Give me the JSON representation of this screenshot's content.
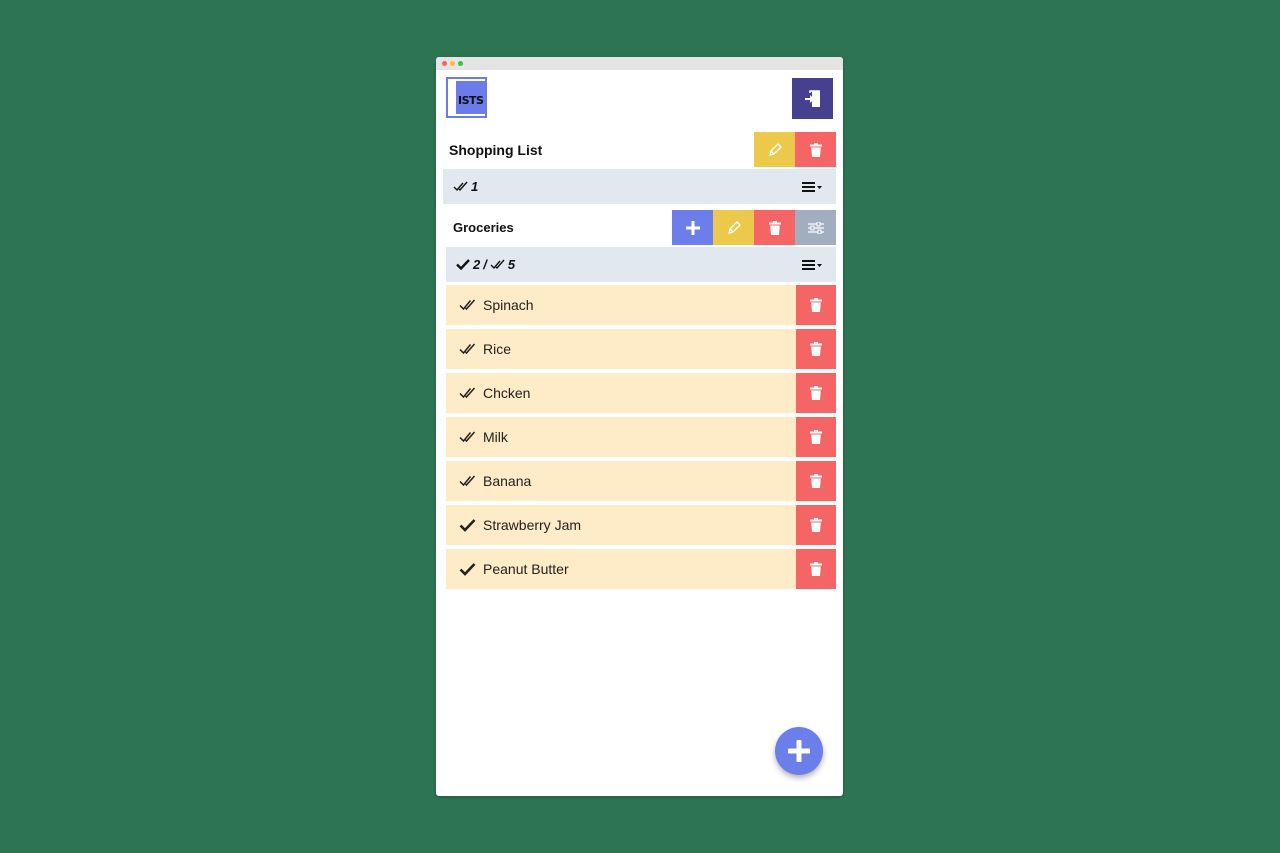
{
  "app": {
    "logo_text": "ISTS"
  },
  "list": {
    "title": "Shopping List",
    "count": "1"
  },
  "category": {
    "title": "Groceries",
    "checked_count": "2",
    "separator": "/",
    "total_count": "5"
  },
  "items": [
    {
      "name": "Spinach",
      "state": "double-check"
    },
    {
      "name": "Rice",
      "state": "double-check"
    },
    {
      "name": "Chcken",
      "state": "double-check"
    },
    {
      "name": "Milk",
      "state": "double-check"
    },
    {
      "name": "Banana",
      "state": "double-check"
    },
    {
      "name": "Strawberry Jam",
      "state": "check"
    },
    {
      "name": "Peanut Butter",
      "state": "check"
    }
  ],
  "colors": {
    "background": "#2d7453",
    "logout": "#47408f",
    "edit": "#ecc94b",
    "delete": "#f56565",
    "add": "#6b7eea",
    "settings": "#a0aec0",
    "count_bar": "#e2e8f0",
    "item": "#feebc8"
  },
  "icons": {
    "logout": "logout-icon",
    "edit": "pencil-icon",
    "delete": "trash-icon",
    "add": "plus-icon",
    "settings": "sliders-icon",
    "menu": "list-menu-icon",
    "checked": "check-icon",
    "all_checked": "double-check-icon"
  }
}
